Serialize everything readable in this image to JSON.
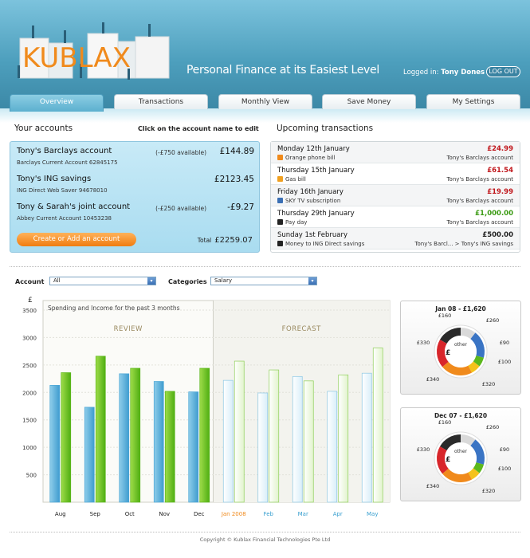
{
  "header": {
    "logo_text": "KUBLAX",
    "tagline": "Personal Finance at its Easiest Level",
    "logged_in_label": "Logged in:",
    "user_name": "Tony Dones",
    "logout": "LOG OUT",
    "brand_color": "#4d9fbd",
    "accent_color": "#f07c10"
  },
  "tabs": [
    {
      "label": "Overview",
      "active": true
    },
    {
      "label": "Transactions",
      "active": false
    },
    {
      "label": "Monthly View",
      "active": false
    },
    {
      "label": "Save Money",
      "active": false
    },
    {
      "label": "My Settings",
      "active": false
    }
  ],
  "accounts": {
    "title": "Your accounts",
    "hint": "Click on the account name to edit",
    "items": [
      {
        "name": "Tony's Barclays account",
        "sub": "Barclays Current Account 62845175",
        "available": "(-£750 available)",
        "balance": "£144.89"
      },
      {
        "name": "Tony's ING savings",
        "sub": "ING Direct Web Saver 94678010",
        "available": "",
        "balance": "£2123.45"
      },
      {
        "name": "Tony & Sarah's joint account",
        "sub": "Abbey Current Account 10453238",
        "available": "(-£250 available)",
        "balance": "-£9.27"
      }
    ],
    "create_button": "Create or Add an account",
    "total_label": "Total",
    "total_value": "£2259.07"
  },
  "upcoming": {
    "title": "Upcoming transactions",
    "items": [
      {
        "date": "Monday 12th January",
        "desc": "Orange phone bill",
        "icon": "phone-icon",
        "amount": "£24.99",
        "color": "#c0161b",
        "account": "Tony's Barclays account"
      },
      {
        "date": "Thursday 15th January",
        "desc": "Gas bill",
        "icon": "flame-icon",
        "amount": "£61.54",
        "color": "#c0161b",
        "account": "Tony's Barclays account"
      },
      {
        "date": "Friday 16th January",
        "desc": "SKY TV subscription",
        "icon": "tv-icon",
        "amount": "£19.99",
        "color": "#c0161b",
        "account": "Tony's Barclays account"
      },
      {
        "date": "Thursday 29th January",
        "desc": "Pay day",
        "icon": "pound-icon",
        "amount": "£1,000.00",
        "color": "#3a9a12",
        "account": "Tony's Barclays account"
      },
      {
        "date": "Sunday 1st February",
        "desc": "Money to ING Direct savings",
        "icon": "pound-icon",
        "amount": "£500.00",
        "color": "#222222",
        "account": "Tony's Barcl... > Tony's ING savings"
      }
    ]
  },
  "filters": {
    "account_label": "Account",
    "account_value": "All",
    "category_label": "Categories",
    "category_value": "Salary"
  },
  "chart_data": {
    "type": "bar",
    "title": "Spending and Income for the past 3 months",
    "ylabel": "£",
    "ylim": [
      0,
      3500
    ],
    "yticks": [
      500,
      1000,
      1500,
      2000,
      2500,
      3000,
      3500
    ],
    "sections": [
      "REVIEW",
      "FORECAST"
    ],
    "categories": [
      "Aug",
      "Sep",
      "Oct",
      "Nov",
      "Dec",
      "Jan 2008",
      "Feb",
      "Mar",
      "Apr",
      "May"
    ],
    "forecast_start_index": 5,
    "series": [
      {
        "name": "Spending",
        "color": "#4aa6d6",
        "values": [
          2130,
          1730,
          2340,
          2200,
          2010,
          2220,
          1990,
          2290,
          2020,
          2350
        ]
      },
      {
        "name": "Income",
        "color": "#5cb81c",
        "values": [
          2360,
          2660,
          2440,
          2020,
          2440,
          2570,
          2410,
          2210,
          2320,
          2810
        ]
      }
    ]
  },
  "donuts": [
    {
      "title": "Jan 08 - £1,620",
      "center": "other",
      "labels": [
        "£160",
        "£260",
        "£90",
        "£100",
        "£320",
        "£340",
        "£330"
      ]
    },
    {
      "title": "Dec 07 - £1,620",
      "center": "other",
      "labels": [
        "£160",
        "£260",
        "£90",
        "£100",
        "£320",
        "£340",
        "£330"
      ]
    }
  ],
  "footer": {
    "copyright": "Copyright © Kublax Financial Technologies Pte Ltd"
  }
}
